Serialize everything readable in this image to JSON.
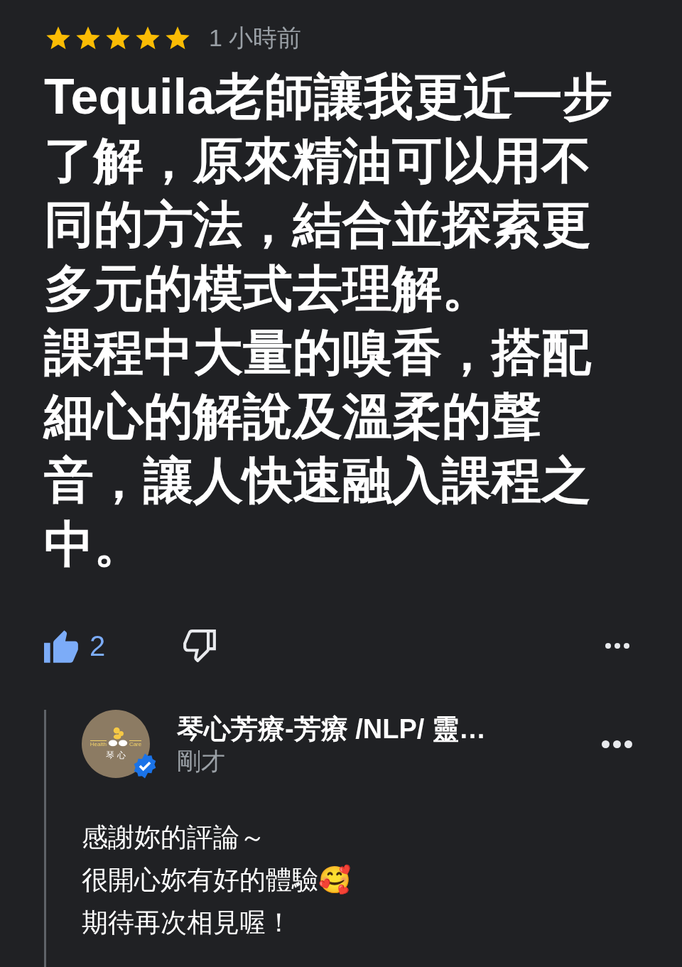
{
  "review": {
    "stars": 5,
    "time": "1 小時前",
    "paragraphs": [
      [
        "Tequila老師讓我更近一步",
        "了解，原來精油可以用不",
        "同的方法，結合並探索更",
        "多元的模式去理解。"
      ],
      [
        "課程中大量的嗅香，搭配",
        "細心的解說及溫柔的聲",
        "音，讓人快速融入課程之",
        "中。"
      ]
    ],
    "likes": "2",
    "liked": true
  },
  "reply": {
    "avatar": {
      "left_text": "Health",
      "right_text": "Care",
      "name": "琴 心",
      "verified": true
    },
    "author": "琴心芳療-芳療 /NLP/ 靈…",
    "time": "剛才",
    "lines": [
      "感謝妳的評論～",
      "很開心妳有好的體驗🥰",
      "期待再次相見喔！"
    ]
  }
}
